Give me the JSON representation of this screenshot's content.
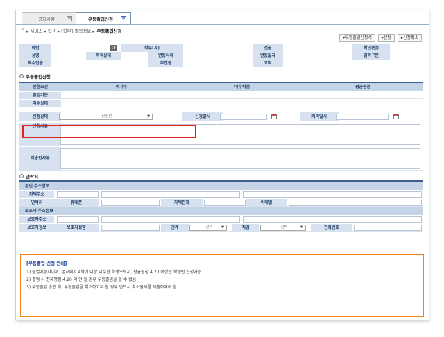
{
  "tabs": [
    {
      "label": "공지사항",
      "close": "⊠"
    },
    {
      "label": "우등졸업신청",
      "close": "⊠"
    }
  ],
  "breadcrumb": {
    "home": "⌂",
    "path": "▸ 서비스 ▸ 학생 ▸ [학부] 졸업정보 ▸",
    "current": "우등졸업신청"
  },
  "buttons": {
    "print": "▸우등졸업신청서",
    "apply": "▸신청",
    "cancel": "▸신청취소"
  },
  "student": {
    "student_id": "학번",
    "major_name": "학부(과)",
    "major": "전공",
    "grade": "학년(반)",
    "name": "성명",
    "status": "학적상태",
    "change_reason": "변동사유",
    "change_date": "변동일자",
    "entry_type": "입학구분",
    "double_major": "복수전공",
    "minor": "부전공",
    "teaching": "교직"
  },
  "section_apply": "우등졸업신청",
  "apply_table": {
    "col0": "신청요건",
    "col1": "학기수",
    "col2": "이수학점",
    "col3": "평균평점",
    "r1": "졸업기준",
    "r2": "이수상태",
    "apply_status": "신청상태",
    "apply_status_select": "-신청안-",
    "apply_date": "신청일시",
    "process_date": "처리일시",
    "apply_reason": "신청사유",
    "reject_reason": "미승인사유"
  },
  "section_contact": "연락처",
  "contact": {
    "self_addr_title": "본인 주소정보",
    "home_addr": "자택주소",
    "contact": "연락처",
    "mobile": "휴대폰",
    "home_phone": "자택전화",
    "email": "이메일",
    "guardian_addr_title": "보호자 주소정보",
    "guardian_addr": "보호자주소",
    "guardian_info": "보호자정보",
    "guardian_name": "보호자성명",
    "relation": "관계",
    "relation_select": "-선택-",
    "job": "직업",
    "job_select": "-선택-",
    "phone": "전화번호"
  },
  "notice": {
    "title": "[우등졸업 신청 안내]",
    "lines": [
      "1) 졸업예정자이며, 본교에서 4학기 이상 이수한 학생으로서, 평균평점 4.20  이상인 학생만 신청가능",
      "2) 졸업 시 전체평점 4.20  이 안 될 경우 우등졸업을 할 수 없음.",
      "3) 우등졸업 승인 후, 우등졸업을 취소하고자 할 경우 반드시 취소원서를 제출하여야 함."
    ]
  }
}
